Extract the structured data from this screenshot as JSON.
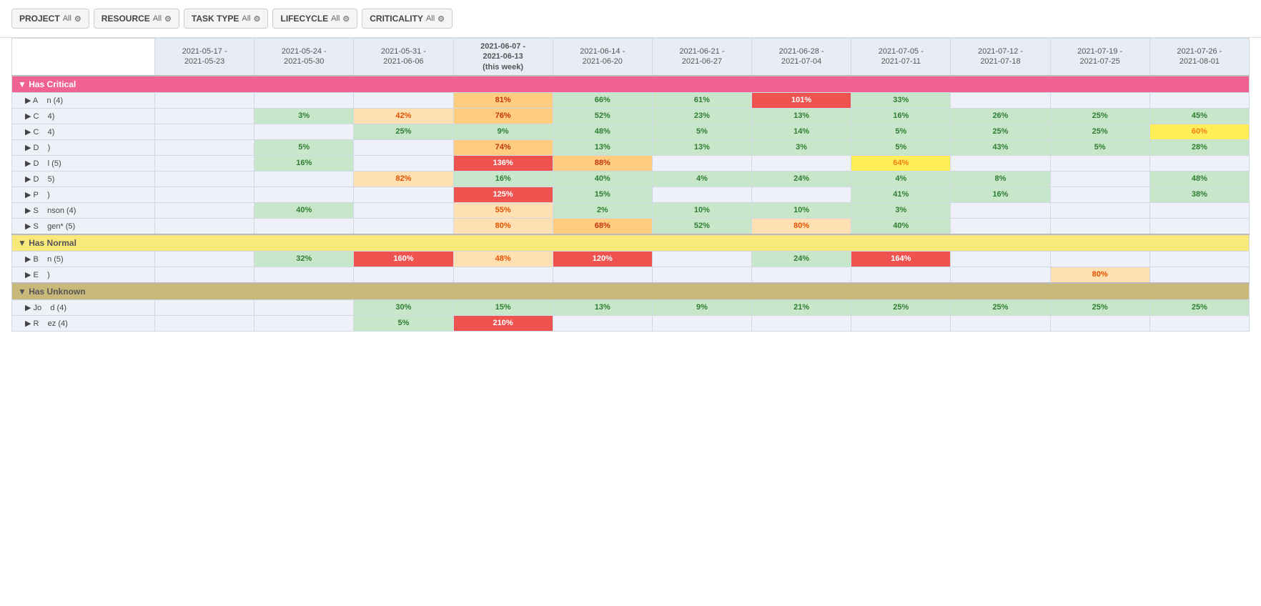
{
  "toolbar": {
    "filters": [
      {
        "label": "PROJECT",
        "badge": "All",
        "icon": "⚙"
      },
      {
        "label": "RESOURCE",
        "badge": "All",
        "icon": "⚙"
      },
      {
        "label": "TASK TYPE",
        "badge": "All",
        "icon": "⚙"
      },
      {
        "label": "LIFECYCLE",
        "badge": "All",
        "icon": "⚙"
      },
      {
        "label": "CRITICALITY",
        "badge": "All",
        "icon": "⚙"
      }
    ]
  },
  "columns": [
    {
      "id": "label",
      "header": "",
      "subheader": ""
    },
    {
      "id": "w1",
      "header": "2021-05-17 -",
      "subheader": "2021-05-23"
    },
    {
      "id": "w2",
      "header": "2021-05-24 -",
      "subheader": "2021-05-30"
    },
    {
      "id": "w3",
      "header": "2021-05-31 -",
      "subheader": "2021-06-06"
    },
    {
      "id": "w4",
      "header": "2021-06-07 -",
      "subheader": "2021-06-13",
      "note": "(this week)"
    },
    {
      "id": "w5",
      "header": "2021-06-14 -",
      "subheader": "2021-06-20"
    },
    {
      "id": "w6",
      "header": "2021-06-21 -",
      "subheader": "2021-06-27"
    },
    {
      "id": "w7",
      "header": "2021-06-28 -",
      "subheader": "2021-07-04"
    },
    {
      "id": "w8",
      "header": "2021-07-05 -",
      "subheader": "2021-07-11"
    },
    {
      "id": "w9",
      "header": "2021-07-12 -",
      "subheader": "2021-07-18"
    },
    {
      "id": "w10",
      "header": "2021-07-19 -",
      "subheader": "2021-07-25"
    },
    {
      "id": "w11",
      "header": "2021-07-26 -",
      "subheader": "2021-08-01"
    }
  ],
  "groups": [
    {
      "id": "critical",
      "label": "Has Critical",
      "type": "critical",
      "rows": [
        {
          "label": "▶ A   n (4)",
          "cells": [
            "",
            "",
            "",
            "81%",
            "66%",
            "61%",
            "101%",
            "33%",
            "",
            "",
            ""
          ]
        },
        {
          "label": "▶ C   4)",
          "cells": [
            "",
            "3%",
            "42%",
            "76%",
            "52%",
            "23%",
            "13%",
            "16%",
            "26%",
            "25%",
            "45%"
          ]
        },
        {
          "label": "▶ C   4)",
          "cells": [
            "",
            "",
            "25%",
            "9%",
            "48%",
            "5%",
            "14%",
            "5%",
            "25%",
            "25%",
            "60%"
          ]
        },
        {
          "label": "▶ D   )",
          "cells": [
            "",
            "5%",
            "",
            "74%",
            "13%",
            "13%",
            "3%",
            "5%",
            "43%",
            "5%",
            "28%"
          ]
        },
        {
          "label": "▶ D   l (5)",
          "cells": [
            "",
            "16%",
            "",
            "136%",
            "88%",
            "",
            "",
            "64%",
            "",
            "",
            ""
          ]
        },
        {
          "label": "▶ D   5)",
          "cells": [
            "",
            "",
            "82%",
            "16%",
            "40%",
            "4%",
            "24%",
            "4%",
            "8%",
            "",
            "48%"
          ]
        },
        {
          "label": "▶ P   )",
          "cells": [
            "",
            "",
            "",
            "125%",
            "15%",
            "",
            "",
            "41%",
            "16%",
            "",
            "38%"
          ]
        },
        {
          "label": "▶ S   nson (4)",
          "cells": [
            "",
            "40%",
            "",
            "55%",
            "2%",
            "10%",
            "10%",
            "3%",
            "",
            "",
            ""
          ]
        },
        {
          "label": "▶ S   gen* (5)",
          "cells": [
            "",
            "",
            "",
            "80%",
            "68%",
            "52%",
            "80%",
            "40%",
            "",
            "",
            ""
          ]
        }
      ]
    },
    {
      "id": "normal",
      "label": "Has Normal",
      "type": "normal",
      "rows": [
        {
          "label": "▶ B   n (5)",
          "cells": [
            "",
            "32%",
            "160%",
            "48%",
            "120%",
            "",
            "24%",
            "164%",
            "",
            "",
            ""
          ]
        },
        {
          "label": "▶ E   )",
          "cells": [
            "",
            "",
            "",
            "",
            "",
            "",
            "",
            "",
            "",
            "80%",
            ""
          ]
        }
      ]
    },
    {
      "id": "unknown",
      "label": "Has Unknown",
      "type": "unknown",
      "rows": [
        {
          "label": "▶ Jo   d (4)",
          "cells": [
            "",
            "",
            "30%",
            "15%",
            "13%",
            "9%",
            "21%",
            "25%",
            "25%",
            "25%",
            "25%"
          ]
        },
        {
          "label": "▶ R   ez (4)",
          "cells": [
            "",
            "",
            "5%",
            "210%",
            "",
            "",
            "",
            "",
            "",
            "",
            ""
          ]
        }
      ]
    }
  ],
  "cell_styles": {
    "critical_row0": [
      "empty",
      "empty",
      "empty",
      "orange",
      "green-light",
      "green-light",
      "red",
      "green-light",
      "empty",
      "empty",
      "empty"
    ],
    "critical_row1": [
      "empty",
      "green-light",
      "orange-light",
      "orange",
      "green-light",
      "green-light",
      "green-light",
      "green-light",
      "green-light",
      "green-light",
      "green-light"
    ],
    "critical_row2": [
      "empty",
      "empty",
      "green-light",
      "green-light",
      "green-light",
      "green-light",
      "green-light",
      "green-light",
      "green-light",
      "green-light",
      "yellow-bright"
    ],
    "critical_row3": [
      "empty",
      "green-light",
      "empty",
      "orange",
      "green-light",
      "green-light",
      "green-light",
      "green-light",
      "green-light",
      "green-light",
      "green-light"
    ],
    "critical_row4": [
      "empty",
      "green-light",
      "empty",
      "red",
      "orange",
      "empty",
      "empty",
      "yellow-bright",
      "empty",
      "empty",
      "empty"
    ],
    "critical_row5": [
      "empty",
      "empty",
      "orange-light",
      "green-light",
      "green-light",
      "green-light",
      "green-light",
      "green-light",
      "green-light",
      "empty",
      "green-light"
    ],
    "critical_row6": [
      "empty",
      "empty",
      "empty",
      "red",
      "green-light",
      "empty",
      "empty",
      "green-light",
      "green-light",
      "empty",
      "green-light"
    ],
    "critical_row7": [
      "empty",
      "green-light",
      "empty",
      "orange-light",
      "green-light",
      "green-light",
      "green-light",
      "green-light",
      "empty",
      "empty",
      "empty"
    ],
    "critical_row8": [
      "empty",
      "empty",
      "empty",
      "orange",
      "orange",
      "green-light",
      "orange",
      "green-light",
      "empty",
      "empty",
      "empty"
    ],
    "normal_row0": [
      "empty",
      "green-light",
      "red",
      "orange-light",
      "red",
      "empty",
      "green-light",
      "red",
      "empty",
      "empty",
      "empty"
    ],
    "normal_row1": [
      "empty",
      "empty",
      "empty",
      "empty",
      "empty",
      "empty",
      "empty",
      "empty",
      "empty",
      "orange-light",
      "empty"
    ],
    "unknown_row0": [
      "empty",
      "empty",
      "green-light",
      "green-light",
      "green-light",
      "green-light",
      "green-light",
      "green-light",
      "green-light",
      "green-light",
      "green-light"
    ],
    "unknown_row1": [
      "empty",
      "empty",
      "green-light",
      "red",
      "empty",
      "empty",
      "empty",
      "empty",
      "empty",
      "empty",
      "empty"
    ]
  }
}
